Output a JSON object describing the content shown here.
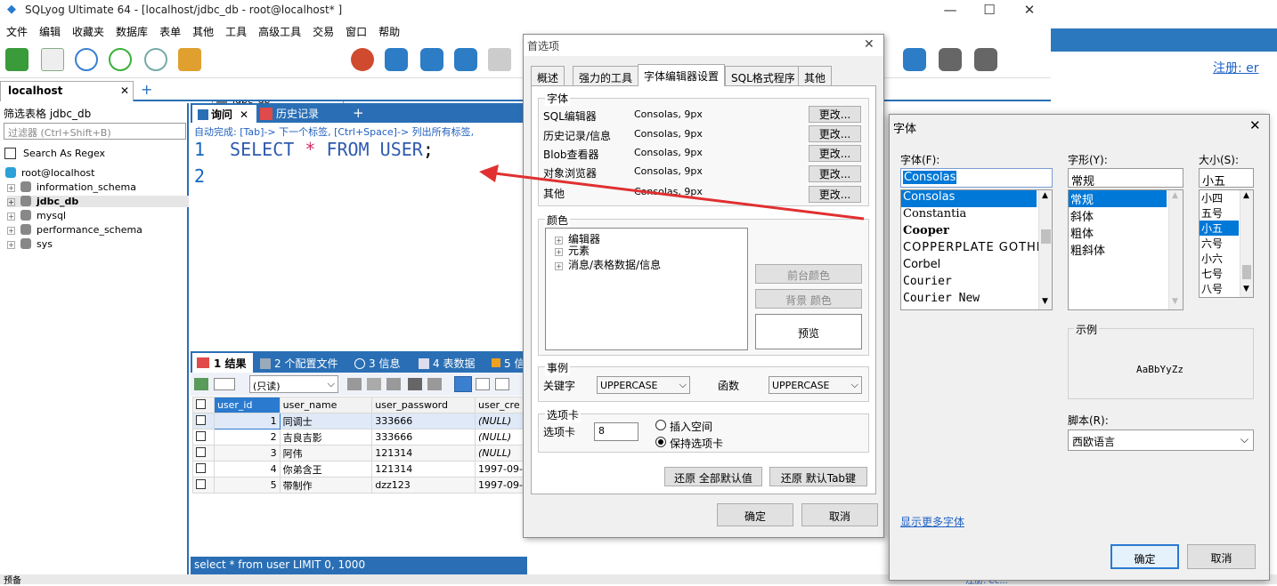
{
  "app": {
    "title": "SQLyog Ultimate 64 - [localhost/jdbc_db - root@localhost* ]",
    "window_controls": [
      "—",
      "☐",
      "✕"
    ]
  },
  "menu": [
    "文件",
    "编辑",
    "收藏夹",
    "数据库",
    "表单",
    "其他",
    "工具",
    "高级工具",
    "交易",
    "窗口",
    "帮助"
  ],
  "toolbar": {
    "db_select": "jdbc_db",
    "register_link": "注册: er"
  },
  "connection_tab": {
    "label": "localhost",
    "close": "✕",
    "add": "+"
  },
  "object_browser": {
    "filter_header": "筛选表格 jdbc_db",
    "filter_placeholder": "过滤器 (Ctrl+Shift+B)",
    "regex_label": "Search As Regex",
    "root": "root@localhost",
    "databases": [
      "information_schema",
      "jdbc_db",
      "mysql",
      "performance_schema",
      "sys"
    ],
    "selected_db": "jdbc_db"
  },
  "query": {
    "tabs": [
      {
        "label": "询问"
      },
      {
        "label": "历史记录"
      }
    ],
    "autocomplete_hint": "自动完成: [Tab]-> 下一个标签, [Ctrl+Space]-> 列出所有标签,",
    "lines": [
      "1",
      "2"
    ],
    "sql_keyword1": "SELECT",
    "sql_star": "*",
    "sql_keyword2": "FROM",
    "sql_table": "USER",
    "sql_semi": ";"
  },
  "results": {
    "tabs": [
      "1 结果",
      "2 个配置文件",
      "3 信息",
      "4 表数据",
      "5 信"
    ],
    "readonly": "(只读)",
    "columns": [
      "user_id",
      "user_name",
      "user_password",
      "user_cre"
    ],
    "rows": [
      [
        "1",
        "同调士",
        "333666",
        "(NULL)"
      ],
      [
        "2",
        "吉良吉影",
        "333666",
        "(NULL)"
      ],
      [
        "3",
        "阿伟",
        "121314",
        "(NULL)"
      ],
      [
        "4",
        "你弟含王",
        "121314",
        "1997-09-"
      ],
      [
        "5",
        "带制作",
        "dzz123",
        "1997-09-"
      ]
    ]
  },
  "status": {
    "query": "select * from user LIMIT 0, 1000",
    "bottom_left": "预备",
    "bottom_right": "注册: ec..."
  },
  "prefs_dialog": {
    "title": "首选项",
    "tabs": [
      "概述",
      "强力的工具",
      "字体编辑器设置",
      "SQL格式程序",
      "其他"
    ],
    "active_tab": "字体编辑器设置",
    "font_group": "字体",
    "font_rows": [
      {
        "label": "SQL编辑器",
        "value": "Consolas, 9px"
      },
      {
        "label": "历史记录/信息",
        "value": "Consolas, 9px"
      },
      {
        "label": "Blob查看器",
        "value": "Consolas, 9px"
      },
      {
        "label": "对象浏览器",
        "value": "Consolas, 9px"
      },
      {
        "label": "其他",
        "value": "Consolas, 9px"
      }
    ],
    "change_btn": "更改...",
    "color_group": "颜色",
    "color_tree": [
      "编辑器",
      "元素",
      "消息/表格数据/信息"
    ],
    "fg_color": "前台颜色",
    "bg_color": "背景 颜色",
    "preview": "预览",
    "case_group": "事例",
    "keyword_label": "关键字",
    "keyword_value": "UPPERCASE",
    "function_label": "函数",
    "function_value": "UPPERCASE",
    "tab_group": "选项卡",
    "tab_label": "选项卡",
    "tab_value": "8",
    "insert_spaces": "插入空间",
    "keep_tabs": "保持选项卡",
    "restore_all": "还原 全部默认值",
    "restore_tab": "还原 默认Tab键",
    "ok": "确定",
    "cancel": "取消"
  },
  "font_dialog": {
    "title": "字体",
    "font_label": "字体(F):",
    "font_value": "Consolas",
    "fonts": [
      "Consolas",
      "Constantia",
      "Cooper",
      "COPPERPLATE GOTHIC",
      "Corbel",
      "Courier",
      "Courier New"
    ],
    "style_label": "字形(Y):",
    "style_value": "常规",
    "styles": [
      "常规",
      "斜体",
      "粗体",
      "粗斜体"
    ],
    "size_label": "大小(S):",
    "size_value": "小五",
    "sizes": [
      "小四",
      "五号",
      "小五",
      "六号",
      "小六",
      "七号",
      "八号"
    ],
    "sample_label": "示例",
    "sample_text": "AaBbYyZz",
    "script_label": "脚本(R):",
    "script_value": "西欧语言",
    "more_fonts": "显示更多字体",
    "ok": "确定",
    "cancel": "取消"
  }
}
